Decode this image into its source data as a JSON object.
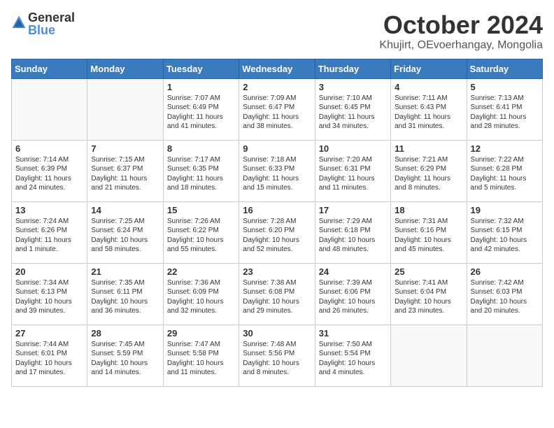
{
  "header": {
    "logo_general": "General",
    "logo_blue": "Blue",
    "month": "October 2024",
    "location": "Khujirt, OEvoerhangay, Mongolia"
  },
  "weekdays": [
    "Sunday",
    "Monday",
    "Tuesday",
    "Wednesday",
    "Thursday",
    "Friday",
    "Saturday"
  ],
  "weeks": [
    [
      {
        "day": "",
        "info": ""
      },
      {
        "day": "",
        "info": ""
      },
      {
        "day": "1",
        "info": "Sunrise: 7:07 AM\nSunset: 6:49 PM\nDaylight: 11 hours and 41 minutes."
      },
      {
        "day": "2",
        "info": "Sunrise: 7:09 AM\nSunset: 6:47 PM\nDaylight: 11 hours and 38 minutes."
      },
      {
        "day": "3",
        "info": "Sunrise: 7:10 AM\nSunset: 6:45 PM\nDaylight: 11 hours and 34 minutes."
      },
      {
        "day": "4",
        "info": "Sunrise: 7:11 AM\nSunset: 6:43 PM\nDaylight: 11 hours and 31 minutes."
      },
      {
        "day": "5",
        "info": "Sunrise: 7:13 AM\nSunset: 6:41 PM\nDaylight: 11 hours and 28 minutes."
      }
    ],
    [
      {
        "day": "6",
        "info": "Sunrise: 7:14 AM\nSunset: 6:39 PM\nDaylight: 11 hours and 24 minutes."
      },
      {
        "day": "7",
        "info": "Sunrise: 7:15 AM\nSunset: 6:37 PM\nDaylight: 11 hours and 21 minutes."
      },
      {
        "day": "8",
        "info": "Sunrise: 7:17 AM\nSunset: 6:35 PM\nDaylight: 11 hours and 18 minutes."
      },
      {
        "day": "9",
        "info": "Sunrise: 7:18 AM\nSunset: 6:33 PM\nDaylight: 11 hours and 15 minutes."
      },
      {
        "day": "10",
        "info": "Sunrise: 7:20 AM\nSunset: 6:31 PM\nDaylight: 11 hours and 11 minutes."
      },
      {
        "day": "11",
        "info": "Sunrise: 7:21 AM\nSunset: 6:29 PM\nDaylight: 11 hours and 8 minutes."
      },
      {
        "day": "12",
        "info": "Sunrise: 7:22 AM\nSunset: 6:28 PM\nDaylight: 11 hours and 5 minutes."
      }
    ],
    [
      {
        "day": "13",
        "info": "Sunrise: 7:24 AM\nSunset: 6:26 PM\nDaylight: 11 hours and 1 minute."
      },
      {
        "day": "14",
        "info": "Sunrise: 7:25 AM\nSunset: 6:24 PM\nDaylight: 10 hours and 58 minutes."
      },
      {
        "day": "15",
        "info": "Sunrise: 7:26 AM\nSunset: 6:22 PM\nDaylight: 10 hours and 55 minutes."
      },
      {
        "day": "16",
        "info": "Sunrise: 7:28 AM\nSunset: 6:20 PM\nDaylight: 10 hours and 52 minutes."
      },
      {
        "day": "17",
        "info": "Sunrise: 7:29 AM\nSunset: 6:18 PM\nDaylight: 10 hours and 48 minutes."
      },
      {
        "day": "18",
        "info": "Sunrise: 7:31 AM\nSunset: 6:16 PM\nDaylight: 10 hours and 45 minutes."
      },
      {
        "day": "19",
        "info": "Sunrise: 7:32 AM\nSunset: 6:15 PM\nDaylight: 10 hours and 42 minutes."
      }
    ],
    [
      {
        "day": "20",
        "info": "Sunrise: 7:34 AM\nSunset: 6:13 PM\nDaylight: 10 hours and 39 minutes."
      },
      {
        "day": "21",
        "info": "Sunrise: 7:35 AM\nSunset: 6:11 PM\nDaylight: 10 hours and 36 minutes."
      },
      {
        "day": "22",
        "info": "Sunrise: 7:36 AM\nSunset: 6:09 PM\nDaylight: 10 hours and 32 minutes."
      },
      {
        "day": "23",
        "info": "Sunrise: 7:38 AM\nSunset: 6:08 PM\nDaylight: 10 hours and 29 minutes."
      },
      {
        "day": "24",
        "info": "Sunrise: 7:39 AM\nSunset: 6:06 PM\nDaylight: 10 hours and 26 minutes."
      },
      {
        "day": "25",
        "info": "Sunrise: 7:41 AM\nSunset: 6:04 PM\nDaylight: 10 hours and 23 minutes."
      },
      {
        "day": "26",
        "info": "Sunrise: 7:42 AM\nSunset: 6:03 PM\nDaylight: 10 hours and 20 minutes."
      }
    ],
    [
      {
        "day": "27",
        "info": "Sunrise: 7:44 AM\nSunset: 6:01 PM\nDaylight: 10 hours and 17 minutes."
      },
      {
        "day": "28",
        "info": "Sunrise: 7:45 AM\nSunset: 5:59 PM\nDaylight: 10 hours and 14 minutes."
      },
      {
        "day": "29",
        "info": "Sunrise: 7:47 AM\nSunset: 5:58 PM\nDaylight: 10 hours and 11 minutes."
      },
      {
        "day": "30",
        "info": "Sunrise: 7:48 AM\nSunset: 5:56 PM\nDaylight: 10 hours and 8 minutes."
      },
      {
        "day": "31",
        "info": "Sunrise: 7:50 AM\nSunset: 5:54 PM\nDaylight: 10 hours and 4 minutes."
      },
      {
        "day": "",
        "info": ""
      },
      {
        "day": "",
        "info": ""
      }
    ]
  ]
}
